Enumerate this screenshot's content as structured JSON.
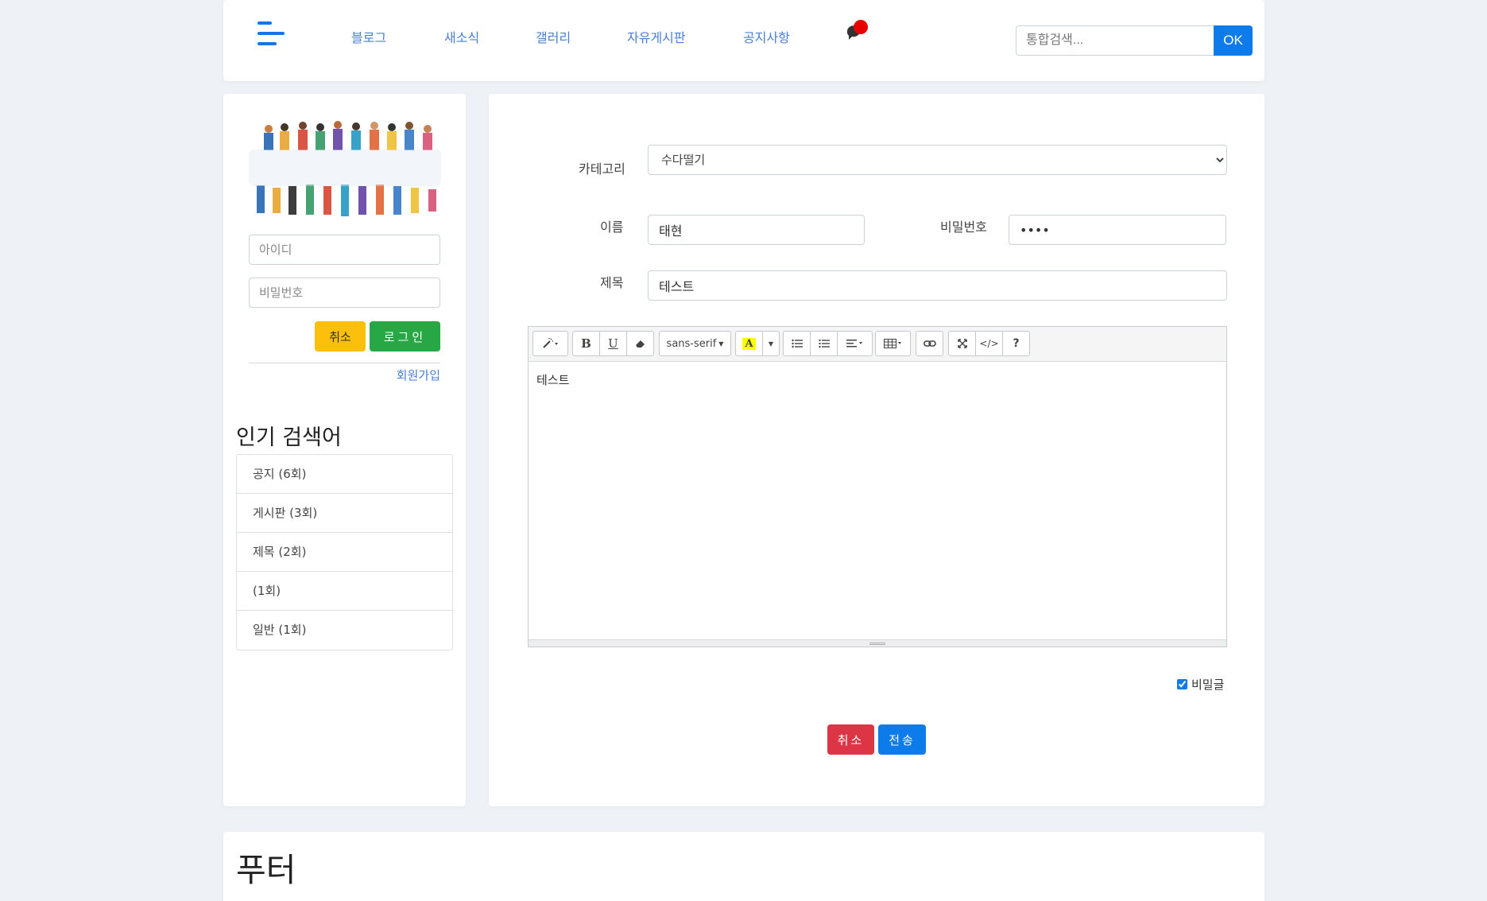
{
  "header": {
    "nav": [
      "블로그",
      "새소식",
      "갤러리",
      "자유게시판",
      "공지사항"
    ],
    "search_placeholder": "통합검색...",
    "search_button": "OK"
  },
  "sidebar": {
    "id_placeholder": "아이디",
    "pw_placeholder": "비밀번호",
    "cancel_label": "취소",
    "login_label": "로그인",
    "signup_label": "회원가입",
    "popular_title": "인기 검색어",
    "popular": [
      "공지 (6회)",
      "게시판 (3회)",
      "제목 (2회)",
      "(1회)",
      "일반 (1회)"
    ]
  },
  "form": {
    "category_label": "카테고리",
    "category_value": "수다떨기",
    "name_label": "이름",
    "name_value": "태현",
    "pw_label": "비밀번호",
    "pw_value": "1234",
    "title_label": "제목",
    "title_value": "테스트",
    "font_name": "sans-serif",
    "body_text": "테스트",
    "secret_label": "비밀글",
    "secret_checked": true,
    "cancel_label": "취소",
    "submit_label": "전송"
  },
  "footer": {
    "title": "푸터"
  },
  "colors": {
    "primary": "#0d7bea",
    "success": "#28a745",
    "warning": "#fbbf0c",
    "danger": "#dc3545",
    "link": "#4a7fd4",
    "background": "#eef1f5"
  },
  "icons": {
    "menu": "hamburger-menu-icon",
    "chat": "chat-notification-icon"
  }
}
